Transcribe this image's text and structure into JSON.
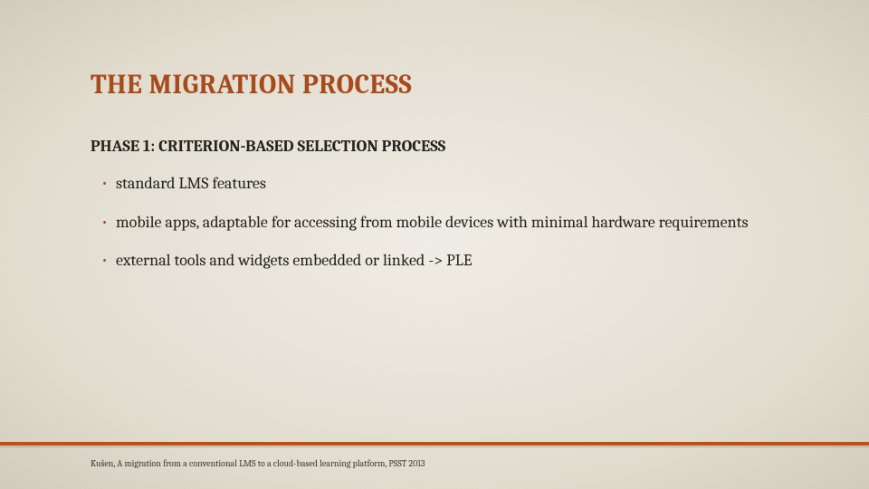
{
  "title": "THE MIGRATION PROCESS",
  "subtitle": "PHASE 1: CRITERION-BASED SELECTION PROCESS",
  "bullets": [
    "standard LMS features",
    "mobile apps, adaptable for accessing from mobile devices with minimal hardware requirements",
    "external tools and widgets embedded or linked -> PLE"
  ],
  "footer": "Kušen, A migration from a conventional LMS to a cloud-based learning platform, PSST 2013",
  "colors": {
    "accent": "#a74b1d",
    "text": "#24241f",
    "background": "#e8e3d7"
  }
}
